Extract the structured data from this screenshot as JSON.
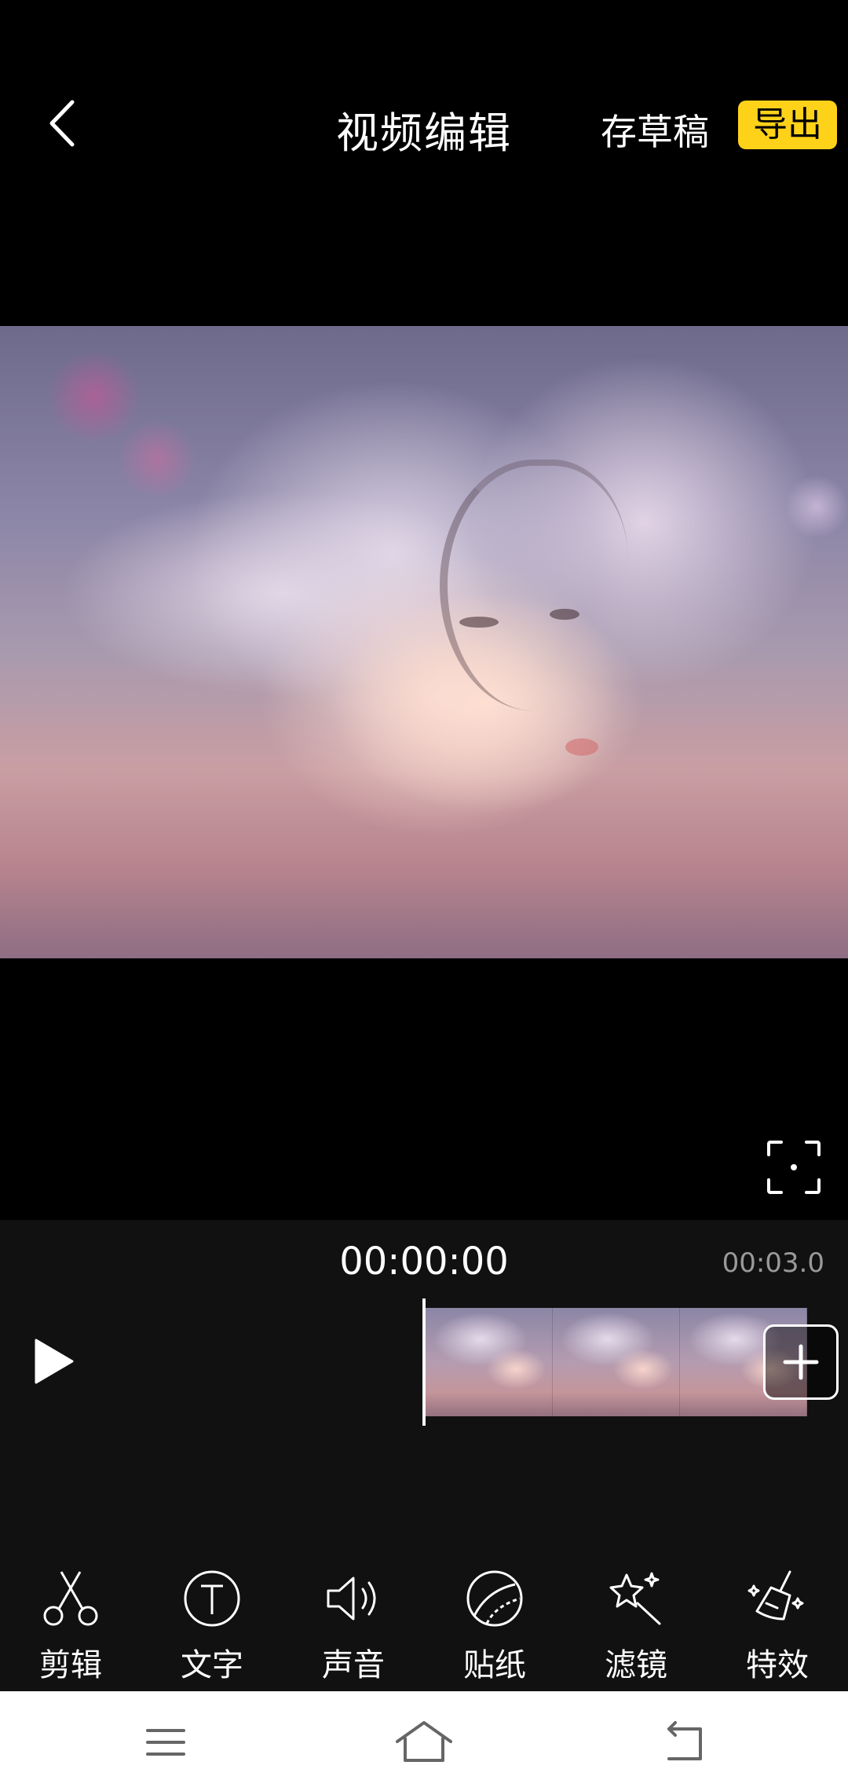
{
  "header": {
    "title": "视频编辑",
    "save_draft_label": "存草稿",
    "export_label": "导出",
    "accent_color": "#ffd21a"
  },
  "icons": {
    "back": "chevron-left-icon",
    "fullscreen": "fullscreen-icon",
    "play": "play-icon",
    "add_clip": "plus-icon"
  },
  "timeline": {
    "current_time": "00:00:00",
    "total_time": "00:03.0",
    "frame_count": 3
  },
  "tools": [
    {
      "label": "剪辑",
      "icon": "scissors-icon"
    },
    {
      "label": "文字",
      "icon": "text-icon"
    },
    {
      "label": "声音",
      "icon": "speaker-icon"
    },
    {
      "label": "贴纸",
      "icon": "sticker-icon"
    },
    {
      "label": "滤镜",
      "icon": "magic-wand-icon"
    },
    {
      "label": "特效",
      "icon": "effects-icon"
    }
  ],
  "system_nav": [
    "menu-icon",
    "home-icon",
    "back-icon"
  ]
}
